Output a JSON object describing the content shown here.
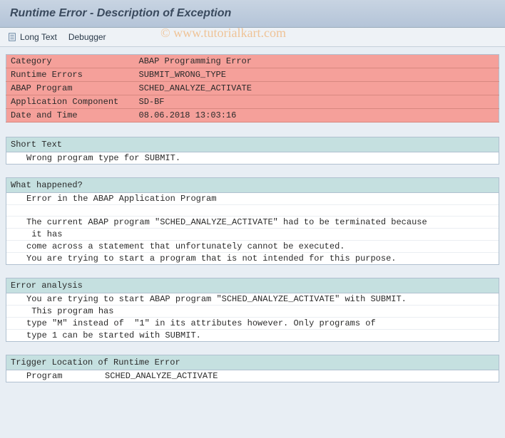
{
  "title": "Runtime Error - Description of Exception",
  "toolbar": {
    "long_text": "Long Text",
    "debugger": "Debugger"
  },
  "info": {
    "category_label": "Category",
    "category_value": "ABAP Programming Error",
    "runtime_errors_label": "Runtime Errors",
    "runtime_errors_value": "SUBMIT_WRONG_TYPE",
    "abap_program_label": "ABAP Program",
    "abap_program_value": "SCHED_ANALYZE_ACTIVATE",
    "app_component_label": "Application Component",
    "app_component_value": "SD-BF",
    "date_time_label": "Date and Time",
    "date_time_value": "08.06.2018 13:03:16"
  },
  "sections": {
    "short_text": {
      "header": "Short Text",
      "line1": "Wrong program type for SUBMIT."
    },
    "what_happened": {
      "header": "What happened?",
      "line1": "Error in the ABAP Application Program",
      "line2": "",
      "line3": "The current ABAP program \"SCHED_ANALYZE_ACTIVATE\" had to be terminated because",
      "line4": " it has",
      "line5": "come across a statement that unfortunately cannot be executed.",
      "line6": "You are trying to start a program that is not intended for this purpose."
    },
    "error_analysis": {
      "header": "Error analysis",
      "line1": "You are trying to start ABAP program \"SCHED_ANALYZE_ACTIVATE\" with SUBMIT.",
      "line2": " This program has",
      "line3": "type \"M\" instead of  \"1\" in its attributes however. Only programs of",
      "line4": "type 1 can be started with SUBMIT."
    },
    "trigger": {
      "header": "Trigger Location of Runtime Error",
      "program_label": "Program",
      "program_value": "SCHED_ANALYZE_ACTIVATE"
    }
  },
  "watermark": "© www.tutorialkart.com"
}
